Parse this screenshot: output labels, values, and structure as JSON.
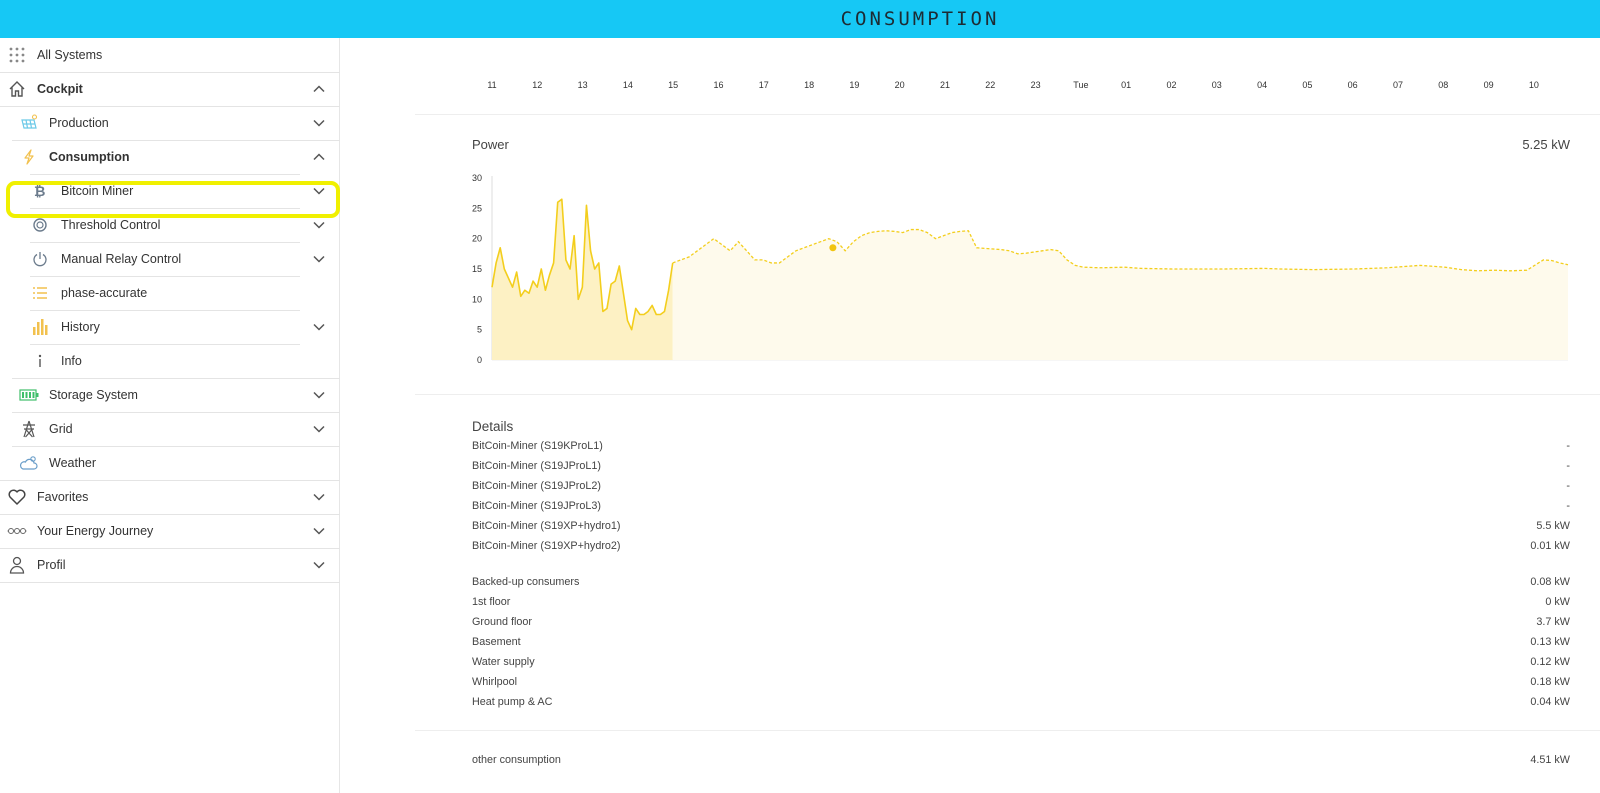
{
  "header": {
    "title": "CONSUMPTION"
  },
  "sidebar": {
    "all_systems": "All Systems",
    "cockpit": "Cockpit",
    "production": "Production",
    "consumption": "Consumption",
    "bitcoin_miner": "Bitcoin Miner",
    "threshold_control": "Threshold Control",
    "manual_relay_control": "Manual Relay Control",
    "phase_accurate": "phase-accurate",
    "history": "History",
    "info": "Info",
    "storage_system": "Storage System",
    "grid": "Grid",
    "weather": "Weather",
    "favorites": "Favorites",
    "energy_journey": "Your Energy Journey",
    "profil": "Profil"
  },
  "timeline": {
    "labels": [
      "11",
      "12",
      "13",
      "14",
      "15",
      "16",
      "17",
      "18",
      "19",
      "20",
      "21",
      "22",
      "23",
      "Tue",
      "01",
      "02",
      "03",
      "04",
      "05",
      "06",
      "07",
      "08",
      "09",
      "10"
    ]
  },
  "power": {
    "title": "Power",
    "value": "5.25 kW"
  },
  "chart_data": {
    "type": "area",
    "yticks": [
      "0",
      "5",
      "10",
      "15",
      "20",
      "25",
      "30"
    ],
    "ylim": [
      0,
      30
    ],
    "measured": [
      [
        0,
        12
      ],
      [
        1,
        16
      ],
      [
        2,
        18.5
      ],
      [
        3,
        15
      ],
      [
        4,
        13.5
      ],
      [
        5,
        12
      ],
      [
        6,
        14.5
      ],
      [
        7,
        10.5
      ],
      [
        8,
        11.5
      ],
      [
        9,
        11
      ],
      [
        10,
        13
      ],
      [
        11,
        12
      ],
      [
        12,
        15
      ],
      [
        13,
        11.5
      ],
      [
        14,
        14
      ],
      [
        15,
        16
      ],
      [
        16,
        26
      ],
      [
        17,
        26.5
      ],
      [
        18,
        16.5
      ],
      [
        19,
        15
      ],
      [
        20,
        20.5
      ],
      [
        21,
        10
      ],
      [
        22,
        12
      ],
      [
        23,
        25.5
      ],
      [
        24,
        18
      ],
      [
        25,
        15
      ],
      [
        26,
        16
      ],
      [
        27,
        8
      ],
      [
        28,
        8.5
      ],
      [
        29,
        12.5
      ],
      [
        30,
        13
      ],
      [
        31,
        15.5
      ],
      [
        32,
        11
      ],
      [
        33,
        6.5
      ],
      [
        34,
        5
      ],
      [
        35,
        8.5
      ],
      [
        36,
        7.5
      ],
      [
        37,
        7.5
      ],
      [
        38,
        8
      ],
      [
        39,
        9
      ],
      [
        40,
        7.5
      ],
      [
        41,
        7.5
      ],
      [
        42,
        8
      ],
      [
        43,
        11.5
      ],
      [
        44,
        16
      ]
    ],
    "forecast": [
      [
        44,
        16
      ],
      [
        46,
        16.5
      ],
      [
        48,
        17
      ],
      [
        50,
        18
      ],
      [
        52,
        19
      ],
      [
        54,
        20
      ],
      [
        56,
        19
      ],
      [
        58,
        18
      ],
      [
        60,
        19.5
      ],
      [
        62,
        18
      ],
      [
        64,
        16.5
      ],
      [
        66,
        16.5
      ],
      [
        68,
        16
      ],
      [
        70,
        16
      ],
      [
        72,
        17
      ],
      [
        74,
        18
      ],
      [
        76,
        18.5
      ],
      [
        78,
        19
      ],
      [
        80,
        19.5
      ],
      [
        82,
        20
      ],
      [
        84,
        19.5
      ],
      [
        86,
        18
      ],
      [
        88,
        19.5
      ],
      [
        90,
        20.5
      ],
      [
        92,
        21
      ],
      [
        94,
        21.2
      ],
      [
        96,
        21.3
      ],
      [
        98,
        21.2
      ],
      [
        100,
        21
      ],
      [
        102,
        21.5
      ],
      [
        104,
        21.5
      ],
      [
        106,
        21
      ],
      [
        108,
        20
      ],
      [
        110,
        20.5
      ],
      [
        112,
        21
      ],
      [
        114,
        21.2
      ],
      [
        116,
        21.3
      ],
      [
        118,
        18.5
      ],
      [
        120,
        18.4
      ],
      [
        122,
        18.3
      ],
      [
        124,
        18.2
      ],
      [
        126,
        18
      ],
      [
        128,
        17.5
      ],
      [
        130,
        17.6
      ],
      [
        132,
        17.8
      ],
      [
        134,
        18
      ],
      [
        136,
        18.2
      ],
      [
        138,
        18
      ],
      [
        140,
        16.5
      ],
      [
        142,
        15.6
      ],
      [
        144,
        15.3
      ],
      [
        148,
        15.2
      ],
      [
        154,
        15.3
      ],
      [
        158,
        15.1
      ],
      [
        166,
        15
      ],
      [
        178,
        15
      ],
      [
        188,
        15.1
      ],
      [
        192,
        15
      ],
      [
        200,
        14.9
      ],
      [
        210,
        15
      ],
      [
        218,
        15.2
      ],
      [
        226,
        15.6
      ],
      [
        232,
        15.3
      ],
      [
        236,
        14.9
      ],
      [
        240,
        14.7
      ],
      [
        244,
        14.8
      ],
      [
        248,
        14.7
      ],
      [
        252,
        14.8
      ],
      [
        256,
        16.5
      ],
      [
        258,
        16.4
      ],
      [
        260,
        16
      ],
      [
        262,
        15.7
      ]
    ],
    "marker": [
      83,
      18.5
    ],
    "colors": {
      "line": "#f3ce1d",
      "fill_measured": "#fdf1c4",
      "fill_forecast": "#fefaec",
      "marker": "#f1c40f"
    }
  },
  "details": {
    "title": "Details",
    "miners": [
      {
        "label": "BitCoin-Miner (S19KProL1)",
        "value": "-"
      },
      {
        "label": "BitCoin-Miner (S19JProL1)",
        "value": "-"
      },
      {
        "label": "BitCoin-Miner (S19JProL2)",
        "value": "-"
      },
      {
        "label": "BitCoin-Miner (S19JProL3)",
        "value": "-"
      },
      {
        "label": "BitCoin-Miner (S19XP+hydro1)",
        "value": "5.5 kW"
      },
      {
        "label": "BitCoin-Miner (S19XP+hydro2)",
        "value": "0.01 kW"
      }
    ],
    "consumers": [
      {
        "label": "Backed-up consumers",
        "value": "0.08 kW"
      },
      {
        "label": "1st floor",
        "value": "0 kW"
      },
      {
        "label": "Ground floor",
        "value": "3.7 kW"
      },
      {
        "label": "Basement",
        "value": "0.13 kW"
      },
      {
        "label": "Water supply",
        "value": "0.12 kW"
      },
      {
        "label": "Whirlpool",
        "value": "0.18 kW"
      },
      {
        "label": "Heat pump & AC",
        "value": "0.04 kW"
      }
    ],
    "other": {
      "label": "other consumption",
      "value": "4.51 kW"
    }
  }
}
